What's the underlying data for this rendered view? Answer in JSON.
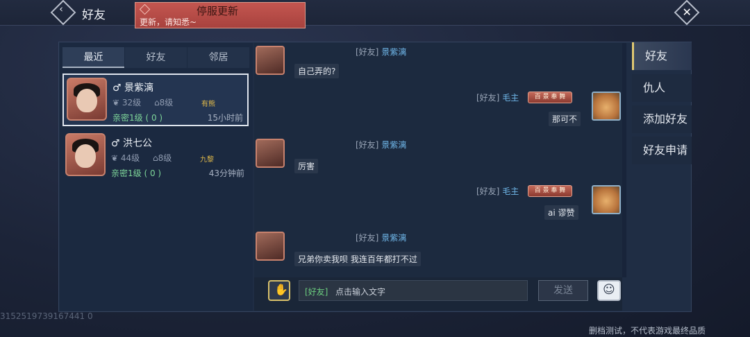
{
  "header": {
    "title": "好友"
  },
  "notice": {
    "title": "停服更新",
    "text": "更新，请知悉~"
  },
  "tabs": [
    "最近",
    "好友",
    "邻居"
  ],
  "friends": [
    {
      "name": "♂ 景紫漓",
      "level": "32级",
      "house": "8级",
      "tag": "有熊",
      "intimacy": "亲密1级 ( 0 )",
      "time": "15小时前"
    },
    {
      "name": "♂ 洪七公",
      "level": "44级",
      "house": "8级",
      "tag": "九黎",
      "intimacy": "亲密1级 ( 0 )",
      "time": "43分钟前"
    }
  ],
  "messages": [
    {
      "prefix": "[好友]",
      "sender": "景紫漓",
      "text": "自己弄的?",
      "side": "left"
    },
    {
      "prefix": "[好友]",
      "sender": "毛主",
      "badge": "百 景 奉 舞",
      "text": "那可不",
      "side": "right"
    },
    {
      "prefix": "[好友]",
      "sender": "景紫漓",
      "text": "厉害",
      "side": "left"
    },
    {
      "prefix": "[好友]",
      "sender": "毛主",
      "badge": "百 景 奉 舞",
      "text": "ai 谬赞",
      "side": "right"
    },
    {
      "prefix": "[好友]",
      "sender": "景紫漓",
      "text": "兄弟你卖我呗 我连百年都打不过",
      "side": "left"
    }
  ],
  "input": {
    "prefix": "[好友]",
    "placeholder": "点击输入文字",
    "send": "发送"
  },
  "menu": [
    "好友",
    "仇人",
    "添加好友",
    "好友申请"
  ],
  "uid": "3152519739167441 0",
  "footer": "删档测试，不代表游戏最终品质"
}
